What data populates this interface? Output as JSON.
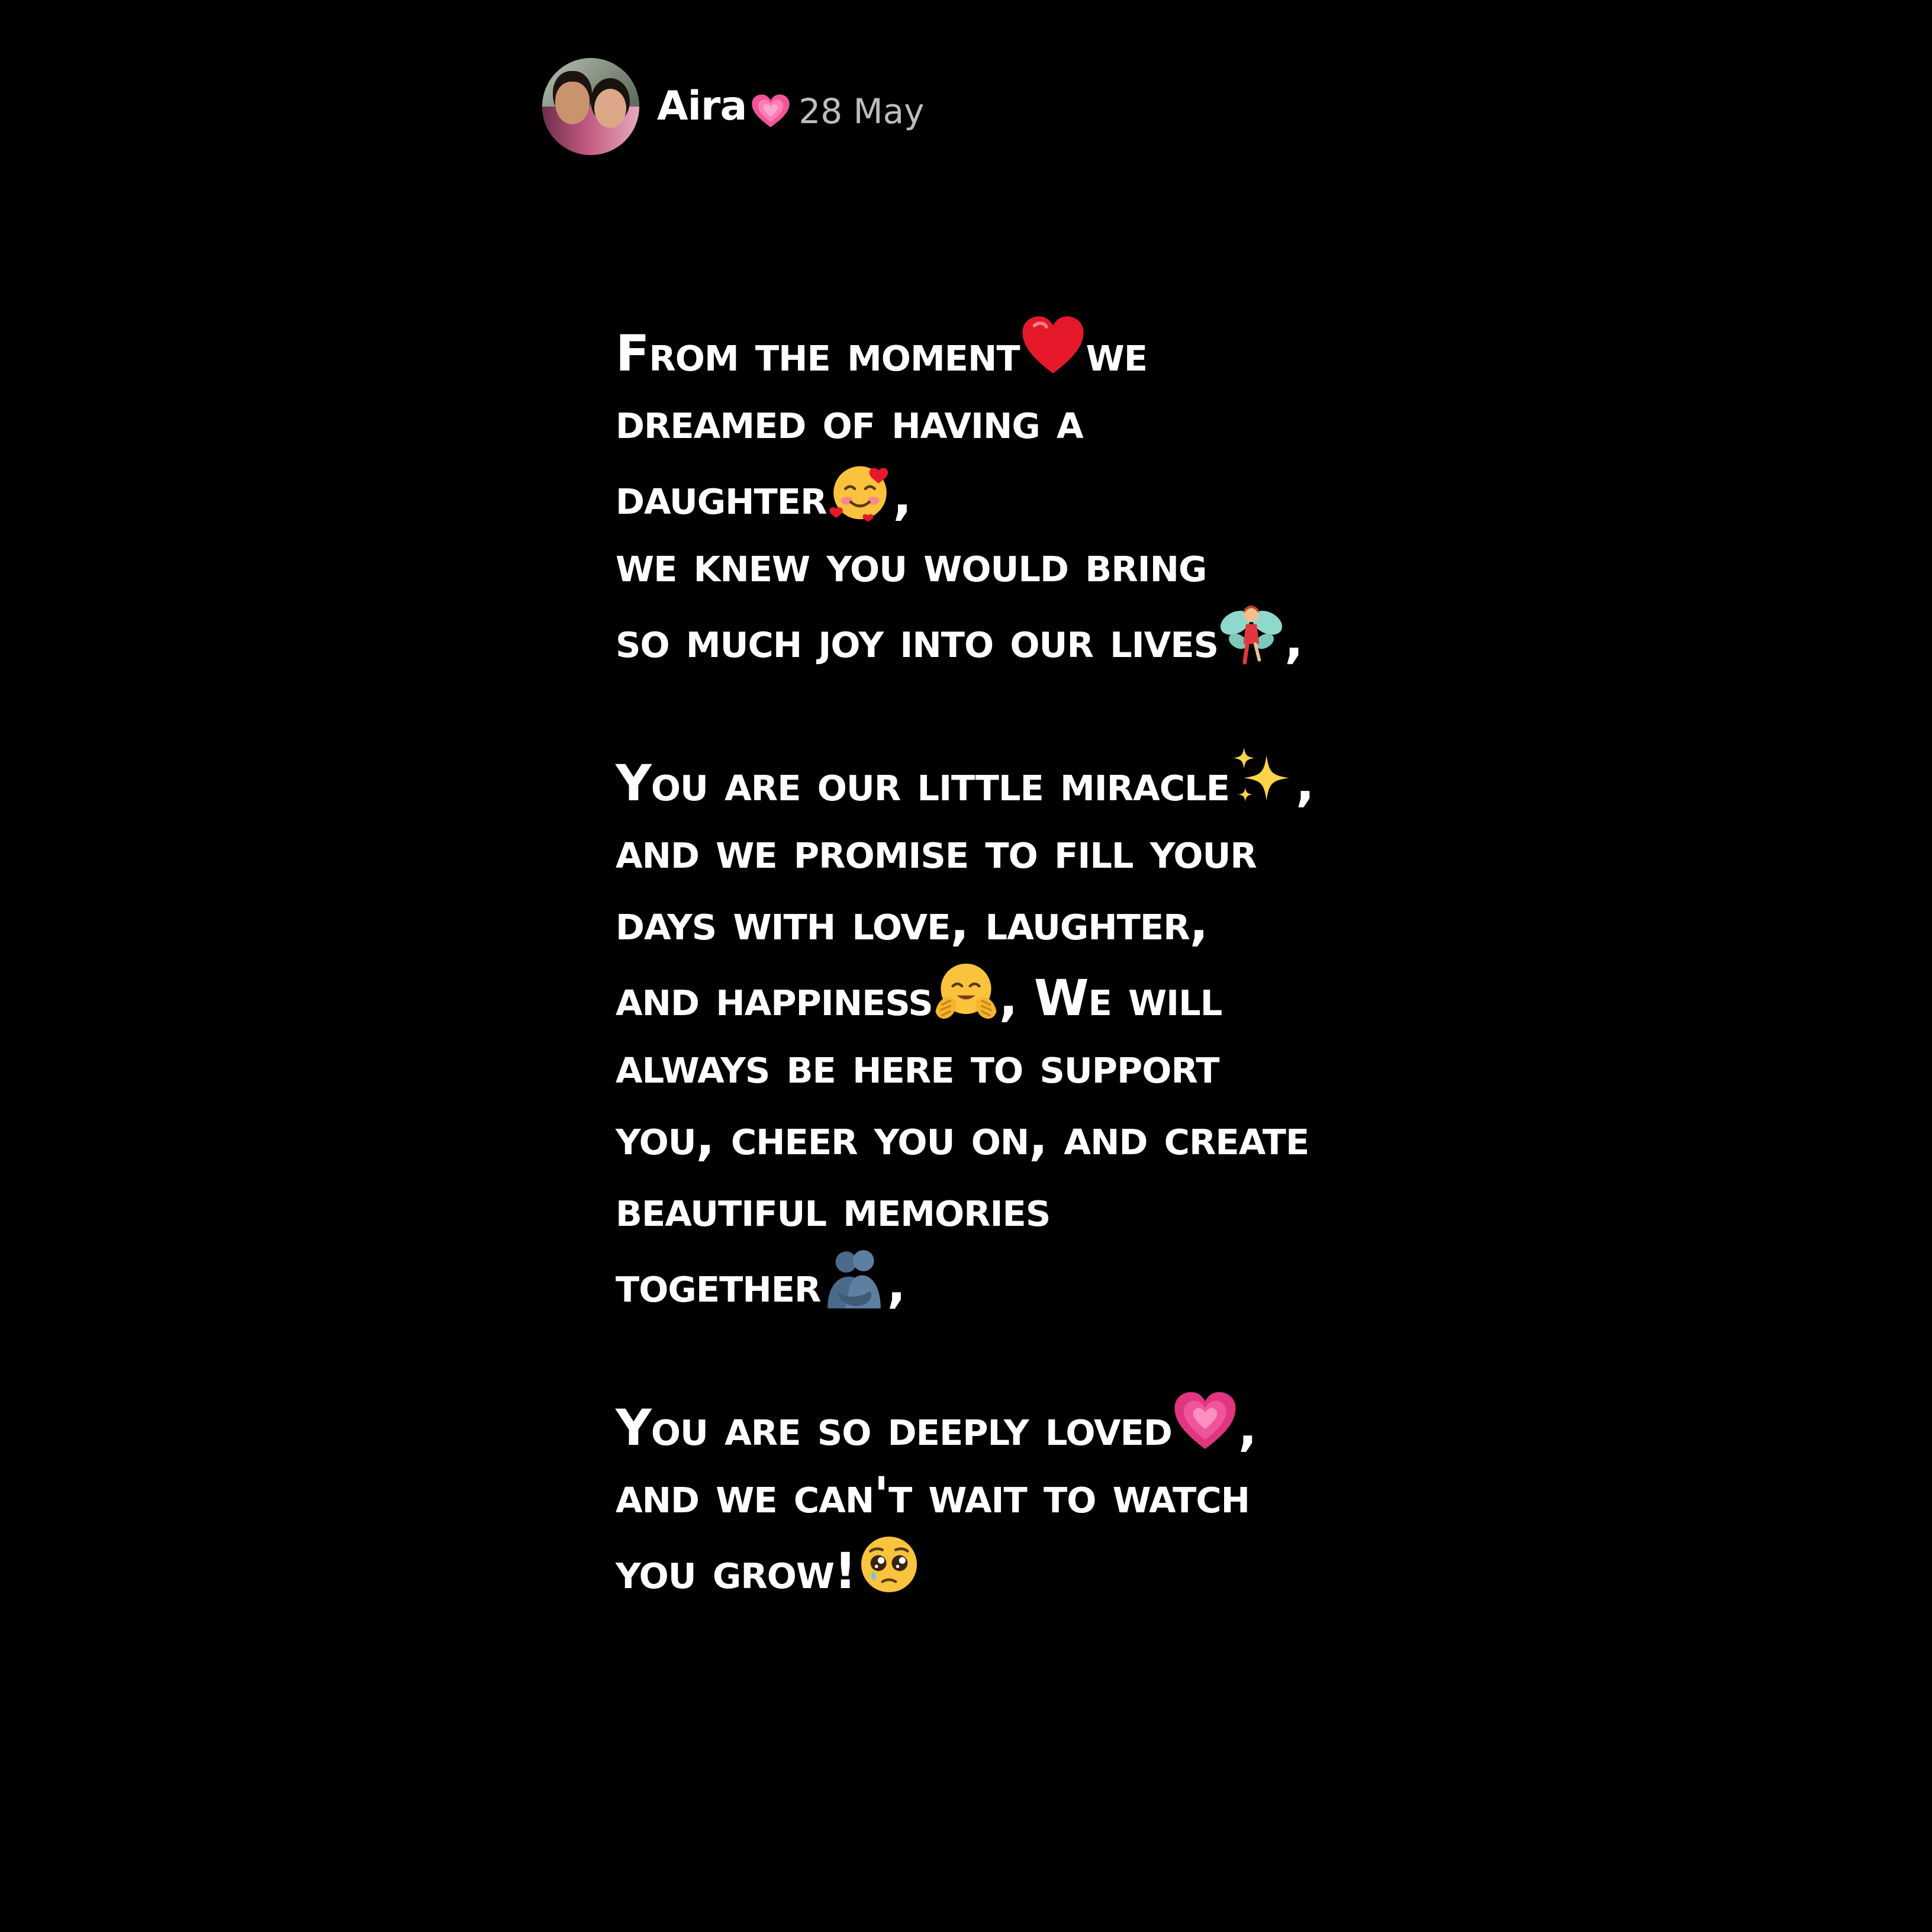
{
  "post": {
    "author": "Aira",
    "date": "28 May",
    "avatar_label": "profile-photo"
  },
  "colors": {
    "background": "#000000",
    "text": "#ffffff",
    "date": "#bdbdbd",
    "heart_red": "#e6192b",
    "heart_pink": "#e83e8c"
  },
  "lines": {
    "l1a": "From the moment",
    "l1b": "we",
    "l2": "dreamed of having a",
    "l3a": "daughter",
    "l3b": ",",
    "l4": "we knew you would bring",
    "l5a": "so much joy into our lives",
    "l5b": ",",
    "l6a": "You are our little miracle",
    "l6b": ",",
    "l7": "and we promise to fill your",
    "l8": "days with love, laughter,",
    "l9a": "and happiness",
    "l9b": ", We will",
    "l10": "always be here to support",
    "l11": "you, cheer you on, and create",
    "l12": "beautiful memories",
    "l13a": "together",
    "l13b": ",",
    "l14a": "You are so deeply loved",
    "l14b": ",",
    "l15": "and we can't wait to watch",
    "l16a": "you grow!"
  },
  "emojis": {
    "name": "growing-heart-icon",
    "e1": "red-heart-icon",
    "e3": "smiling-face-with-hearts-icon",
    "e5": "fairy-icon",
    "e6": "sparkles-icon",
    "e9": "hugging-face-icon",
    "e13": "people-hugging-icon",
    "e14": "growing-heart-icon",
    "e16": "pleading-face-icon"
  }
}
